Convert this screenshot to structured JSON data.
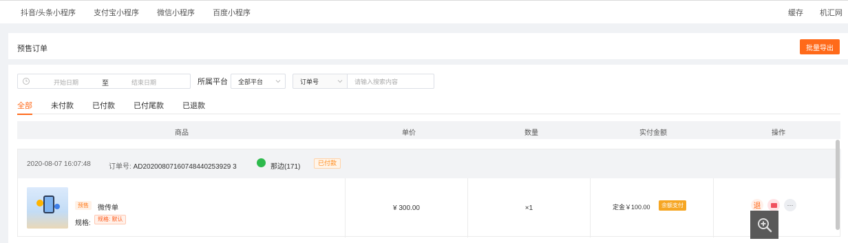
{
  "topnav": {
    "items": [
      "抖音/头条小程序",
      "支付宝小程序",
      "微信小程序",
      "百度小程序"
    ],
    "right": [
      "缓存",
      "机汇网"
    ]
  },
  "header": {
    "title": "预售订单",
    "export_label": "批量导出"
  },
  "filters": {
    "start_placeholder": "开始日期",
    "range_sep": "至",
    "end_placeholder": "结束日期",
    "platform_label": "所属平台",
    "platform_value": "全部平台",
    "search_type": "订单号",
    "search_placeholder": "请输入搜索内容"
  },
  "tabs": [
    {
      "label": "全部",
      "active": true
    },
    {
      "label": "未付款",
      "active": false
    },
    {
      "label": "已付款",
      "active": false
    },
    {
      "label": "已付尾款",
      "active": false
    },
    {
      "label": "已退款",
      "active": false
    }
  ],
  "table": {
    "columns": [
      "商品",
      "单价",
      "数量",
      "实付金额",
      "操作"
    ]
  },
  "order": {
    "time": "2020-08-07 16:07:48",
    "order_no_label": "订单号:",
    "order_no": "AD20200807160748440253929 3",
    "user": "那边(171)",
    "status": "已付款",
    "goods": {
      "tag": "预售",
      "name": "微传单",
      "spec_label": "规格:",
      "spec_value": "规格: 默认"
    },
    "unit_price": "¥ 300.00",
    "quantity": "×1",
    "deposit": "定金￥100.00",
    "balance_button": "余额支付",
    "ops": {
      "refund": "退",
      "more": "···"
    }
  },
  "colors": {
    "accent": "#ff6a1a",
    "wechat": "#2dba4c",
    "balance": "#f6a623"
  }
}
